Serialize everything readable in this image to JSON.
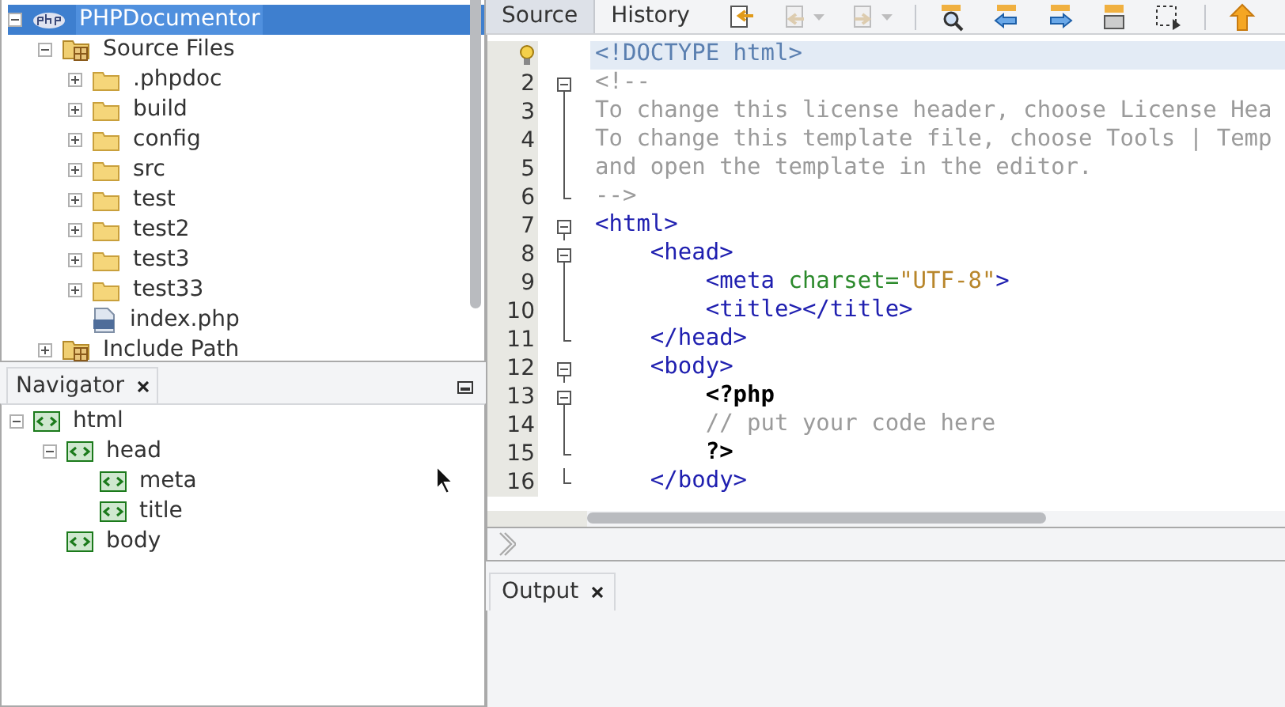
{
  "projects": {
    "items": [
      {
        "label": "PHPDocumentor",
        "kind": "project",
        "selected": true,
        "expanded": true,
        "children": [
          {
            "label": "Source Files",
            "kind": "source-root",
            "selected": false,
            "expanded": true,
            "children": [
              {
                "label": ".phpdoc",
                "kind": "folder",
                "selected": false,
                "expanded": false
              },
              {
                "label": "build",
                "kind": "folder",
                "selected": false,
                "expanded": false
              },
              {
                "label": "config",
                "kind": "folder",
                "selected": false,
                "expanded": false
              },
              {
                "label": "src",
                "kind": "folder",
                "selected": false,
                "expanded": false
              },
              {
                "label": "test",
                "kind": "folder",
                "selected": false,
                "expanded": false
              },
              {
                "label": "test2",
                "kind": "folder",
                "selected": false,
                "expanded": false
              },
              {
                "label": "test3",
                "kind": "folder",
                "selected": false,
                "expanded": false
              },
              {
                "label": "test33",
                "kind": "folder",
                "selected": false,
                "expanded": false
              },
              {
                "label": "index.php",
                "kind": "php-file",
                "selected": false
              }
            ]
          },
          {
            "label": "Include Path",
            "kind": "source-root",
            "selected": false,
            "expanded": false
          }
        ]
      }
    ]
  },
  "navigator": {
    "tab": "Navigator",
    "items": [
      {
        "label": "html",
        "expanded": true,
        "children": [
          {
            "label": "head",
            "expanded": true,
            "children": [
              {
                "label": "meta"
              },
              {
                "label": "title"
              }
            ]
          },
          {
            "label": "body"
          }
        ]
      }
    ]
  },
  "editor": {
    "tabs": [
      {
        "label": "Source",
        "selected": true
      },
      {
        "label": "History",
        "selected": false
      }
    ],
    "toolbar": [
      {
        "kind": "last-edit",
        "disabled": false,
        "dropdown": false
      },
      {
        "kind": "back",
        "disabled": true,
        "dropdown": true
      },
      {
        "kind": "forward",
        "disabled": true,
        "dropdown": true
      },
      {
        "kind": "separator"
      },
      {
        "kind": "find",
        "disabled": false,
        "dropdown": false
      },
      {
        "kind": "prev",
        "disabled": false,
        "dropdown": false
      },
      {
        "kind": "next",
        "disabled": false,
        "dropdown": false
      },
      {
        "kind": "toggle",
        "disabled": false,
        "dropdown": false
      },
      {
        "kind": "select",
        "disabled": false,
        "dropdown": false
      },
      {
        "kind": "separator"
      },
      {
        "kind": "up",
        "disabled": false,
        "dropdown": false
      }
    ],
    "lines": [
      {
        "hint": true,
        "current": true,
        "kind": "plain",
        "segments": [
          {
            "kind": "doctype",
            "text": "<!DOCTYPE html>"
          }
        ]
      },
      {
        "number": "2",
        "current": false,
        "kind": "start",
        "segments": [
          {
            "kind": "comment",
            "text": "<!--"
          }
        ]
      },
      {
        "number": "3",
        "current": false,
        "kind": "inner",
        "segments": [
          {
            "kind": "comment",
            "text": "To change this license header, choose License Hea"
          }
        ]
      },
      {
        "number": "4",
        "current": false,
        "kind": "inner",
        "segments": [
          {
            "kind": "comment",
            "text": "To change this template file, choose Tools | Temp"
          }
        ]
      },
      {
        "number": "5",
        "current": false,
        "kind": "inner",
        "segments": [
          {
            "kind": "comment",
            "text": "and open the template in the editor."
          }
        ]
      },
      {
        "number": "6",
        "current": false,
        "kind": "end",
        "segments": [
          {
            "kind": "comment",
            "text": "-->"
          }
        ]
      },
      {
        "number": "7",
        "current": false,
        "kind": "start",
        "segments": [
          {
            "kind": "tag",
            "text": "<html>"
          }
        ]
      },
      {
        "number": "8",
        "current": false,
        "kind": "start",
        "segments": [
          {
            "kind": "tag",
            "text": "    <head>"
          }
        ]
      },
      {
        "number": "9",
        "current": false,
        "kind": "inner",
        "segments": [
          {
            "kind": "tag",
            "text": "        <meta "
          },
          {
            "kind": "attr",
            "text": "charset="
          },
          {
            "kind": "value",
            "text": "\"UTF-8\""
          },
          {
            "kind": "tag",
            "text": ">"
          }
        ]
      },
      {
        "number": "10",
        "current": false,
        "kind": "inner",
        "segments": [
          {
            "kind": "tag",
            "text": "        <title></title>"
          }
        ]
      },
      {
        "number": "11",
        "current": false,
        "kind": "end",
        "segments": [
          {
            "kind": "tag",
            "text": "    </head>"
          }
        ]
      },
      {
        "number": "12",
        "current": false,
        "kind": "start",
        "segments": [
          {
            "kind": "tag",
            "text": "    <body>"
          }
        ]
      },
      {
        "number": "13",
        "current": false,
        "kind": "start",
        "segments": [
          {
            "kind": "php",
            "text": "        <?php"
          }
        ]
      },
      {
        "number": "14",
        "current": false,
        "kind": "inner",
        "segments": [
          {
            "kind": "comment",
            "text": "        // put your code here"
          }
        ]
      },
      {
        "number": "15",
        "current": false,
        "kind": "end",
        "segments": [
          {
            "kind": "php",
            "text": "        ?>"
          }
        ]
      },
      {
        "number": "16",
        "current": false,
        "kind": "end",
        "segments": [
          {
            "kind": "tag",
            "text": "    </body>"
          }
        ]
      }
    ]
  },
  "output": {
    "tab": "Output"
  }
}
